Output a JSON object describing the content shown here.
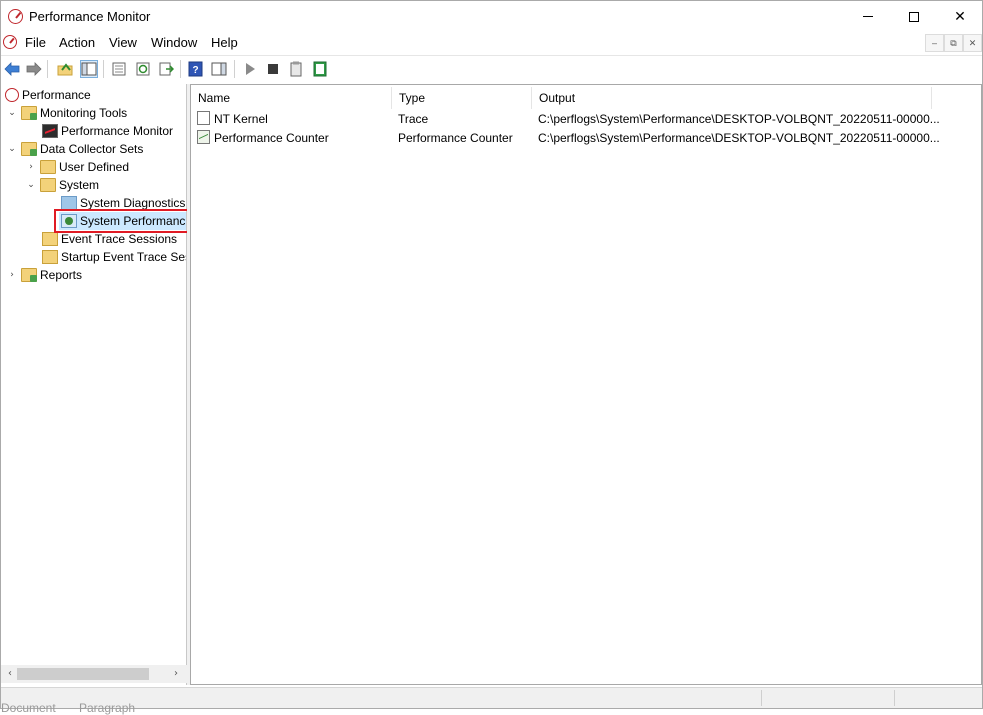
{
  "window": {
    "title": "Performance Monitor",
    "controls": {
      "minimize": "minimize",
      "maximize": "maximize",
      "close": "✕"
    }
  },
  "menu": {
    "items": [
      "File",
      "Action",
      "View",
      "Window",
      "Help"
    ],
    "mdi": {
      "minimize": "–",
      "restore": "⧉",
      "close": "✕"
    }
  },
  "toolbar": {
    "buttons": [
      "back-icon",
      "forward-icon",
      "up-folder-icon",
      "show-hide-tree-icon",
      "properties-icon",
      "refresh-icon",
      "export-list-icon",
      "help-icon",
      "show-hide-action-pane-icon",
      "start-icon",
      "stop-icon",
      "report-icon",
      "latest-report-icon"
    ]
  },
  "tree": {
    "root": "Performance",
    "monitoring_tools": "Monitoring Tools",
    "performance_monitor": "Performance Monitor",
    "data_collector_sets": "Data Collector Sets",
    "user_defined": "User Defined",
    "system": "System",
    "system_diagnostics": "System Diagnostics",
    "system_performance": "System Performanc",
    "event_trace_sessions": "Event Trace Sessions",
    "startup_event_trace": "Startup Event Trace Sess",
    "reports": "Reports"
  },
  "list": {
    "columns": {
      "name": "Name",
      "type": "Type",
      "output": "Output"
    },
    "rows": [
      {
        "name": "NT Kernel",
        "type": "Trace",
        "output": "C:\\perflogs\\System\\Performance\\DESKTOP-VOLBQNT_20220511-00000..."
      },
      {
        "name": "Performance Counter",
        "type": "Performance Counter",
        "output": "C:\\perflogs\\System\\Performance\\DESKTOP-VOLBQNT_20220511-00000..."
      }
    ]
  },
  "status": {
    "under_left": "Document",
    "under_mid": "Paragraph"
  },
  "colors": {
    "highlight": "#e01b24",
    "title_icon": "#c0272d"
  }
}
